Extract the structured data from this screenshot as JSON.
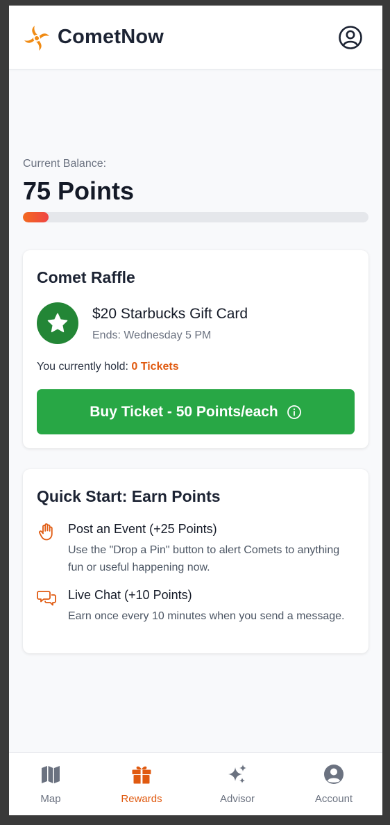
{
  "header": {
    "title": "CometNow",
    "logo_icon": "comet-swirl-icon",
    "account_icon": "user-circle-icon"
  },
  "balance": {
    "label": "Current Balance:",
    "value": "75 Points",
    "progress_fraction": 0.075
  },
  "raffle": {
    "title": "Comet Raffle",
    "prize_icon": "star-icon",
    "prize_name": "$20 Starbucks Gift Card",
    "ends": "Ends: Wednesday 5 PM",
    "hold_prefix": "You currently hold:",
    "hold_count": "0 Tickets",
    "buy_label": "Buy Ticket - 50 Points/each"
  },
  "earn": {
    "title": "Quick Start: Earn Points",
    "items": [
      {
        "icon": "hand-icon",
        "title": "Post an Event (+25 Points)",
        "description": "Use the \"Drop a Pin\" button to alert Comets to anything fun or useful happening now."
      },
      {
        "icon": "chat-bubbles-icon",
        "title": "Live Chat (+10 Points)",
        "description": "Earn once every 10 minutes when you send a message."
      }
    ]
  },
  "nav": {
    "items": [
      {
        "label": "Map",
        "icon": "map-icon"
      },
      {
        "label": "Rewards",
        "icon": "gift-icon",
        "active": true
      },
      {
        "label": "Advisor",
        "icon": "sparkles-icon"
      },
      {
        "label": "Account",
        "icon": "user-circle-icon"
      }
    ]
  },
  "colors": {
    "accent": "#e05a10",
    "primary_green": "#28a745",
    "badge_green": "#238636",
    "text_dark": "#1c2333"
  }
}
